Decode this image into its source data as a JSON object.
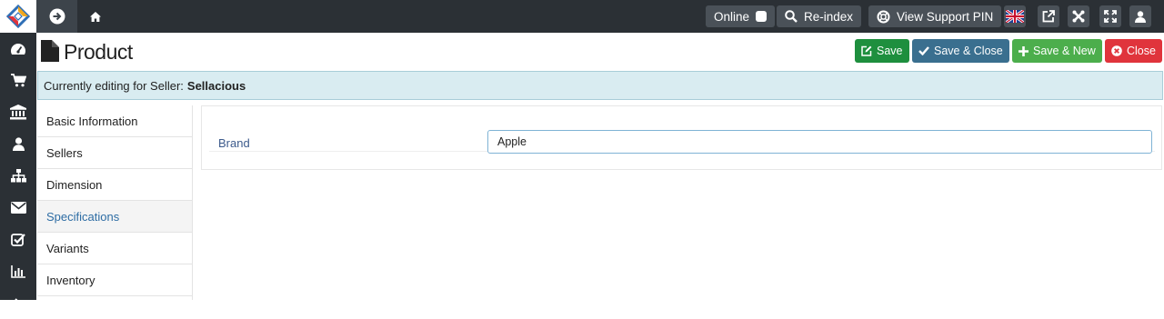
{
  "topbar": {
    "status_label": "Online",
    "reindex_label": "Re-index",
    "support_label": "View Support PIN"
  },
  "page": {
    "title": "Product"
  },
  "actions": {
    "save": "Save",
    "save_close": "Save & Close",
    "save_new": "Save & New",
    "close": "Close"
  },
  "notice": {
    "prefix": "Currently editing for Seller:",
    "seller": "Sellacious"
  },
  "tabs": [
    {
      "label": "Basic Information"
    },
    {
      "label": "Sellers"
    },
    {
      "label": "Dimension"
    },
    {
      "label": "Specifications"
    },
    {
      "label": "Variants"
    },
    {
      "label": "Inventory"
    }
  ],
  "form": {
    "brand_label": "Brand",
    "brand_value": "Apple"
  },
  "colors": {
    "topbar": "#2b3035",
    "save": "#1e8f3e",
    "save_close": "#3a6f8f",
    "save_new": "#4cae4c",
    "close": "#e0343c"
  }
}
